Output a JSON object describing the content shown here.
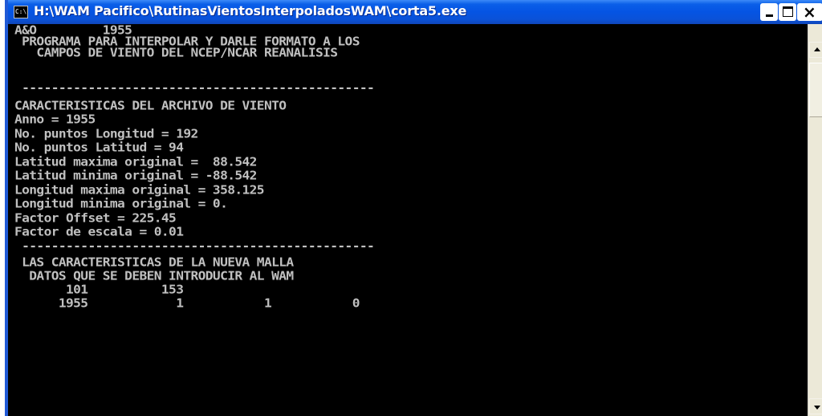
{
  "window": {
    "title": "H:\\WAM Pacifico\\RutinasVientosInterpoladosWAM\\corta5.exe",
    "icon_text": "C:\\",
    "titlebar_color": "#0554e3"
  },
  "console": {
    "text_color": "#c0c0c0",
    "background": "#000000",
    "lines": [
      "A&O         1955",
      " PROGRAMA PARA INTERPOLAR Y DARLE FORMATO A LOS",
      "   CAMPOS DE VIENTO DEL NCEP/NCAR REANALISIS",
      " ------------------------------------------------",
      "CARACTERISTICAS DEL ARCHIVO DE VIENTO",
      "Anno = 1955",
      "No. puntos Longitud = 192",
      "No. puntos Latitud = 94",
      "Latitud maxima original =  88.542",
      "Latitud minima original = -88.542",
      "Longitud maxima original = 358.125",
      "Longitud minima original = 0.",
      "Factor Offset = 225.45",
      "Factor de escala = 0.01",
      " ------------------------------------------------",
      " LAS CARACTERISTICAS DE LA NUEVA MALLA",
      "  DATOS QUE SE DEBEN INTRODUCIR AL WAM",
      "       101          153",
      "      1955            1           1           0"
    ]
  },
  "buttons": {
    "minimize": "minimize",
    "maximize": "maximize",
    "close": "close"
  }
}
